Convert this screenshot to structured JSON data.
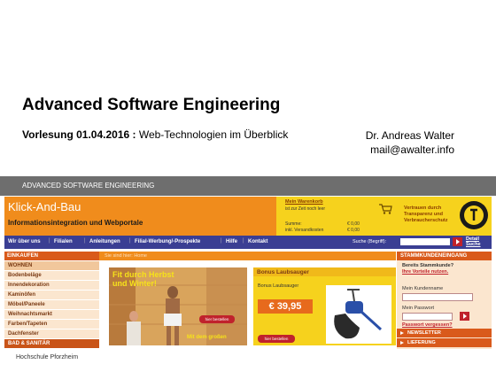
{
  "slide": {
    "title": "Advanced Software Engineering",
    "lecture_label": "Vorlesung 01.04.2016 :",
    "lecture_topic": " Web-Technologien im Überblick",
    "author": "Dr. Andreas Walter",
    "email": "mail@awalter.info",
    "banner": "ADVANCED SOFTWARE ENGINEERING",
    "footer": "Hochschule Pforzheim"
  },
  "site": {
    "brand": "Klick-And-Bau",
    "tagline": "Informationsintegration und Webportale",
    "cart": {
      "title": "Mein Warenkorb",
      "note": "ist zur Zeit noch leer",
      "sum_label": "Summe:",
      "sum_value": "€ 0,00",
      "shipping_label": "inkl. Versandkosten",
      "shipping_value": "€ 0,00"
    },
    "trust": {
      "text": "Vertrauen durch Transparenz und Verbraucherschutz"
    },
    "nav": [
      "Wir über uns",
      "Filialen",
      "Anleitungen",
      "Filial-Werbung/-Prospekte",
      "Hilfe",
      "Kontakt"
    ],
    "search": {
      "label": "Suche (Begriff):",
      "detail": "Detail Suche"
    },
    "categories_header": "EINKAUFEN",
    "categories": [
      "WOHNEN",
      "Bodenbeläge",
      "Innendekoration",
      "Kaminöfen",
      "Möbel/Paneele",
      "Weihnachtsmarkt",
      "Farben/Tapeten",
      "Dachfenster",
      "BAD & SANITÄR"
    ],
    "breadcrumb": "Sie sind hier: Home",
    "promo": {
      "headline": "Fit durch Herbst und Winter!",
      "button": "hier bestellen",
      "link": "Mit dem großen"
    },
    "bonus": {
      "header": "Bonus Laubsauger",
      "name": "Bonus Laubsauger",
      "price": "€ 39,95",
      "button": "hier bestellen"
    },
    "login": {
      "header": "STAMMKUNDENEINGANG",
      "question": "Bereits Stammkunde?",
      "benefits_link": "Ihre Vorteile nutzen.",
      "name_label": "Mein Kundenname",
      "password_label": "Mein Passwort",
      "forgot_link": "Passwort vergessen?"
    },
    "side_links": [
      "NEWSLETTER",
      "LIEFERUNG"
    ]
  },
  "colors": {
    "orange": "#f08c1c",
    "nav_blue": "#3a3e93",
    "yellow": "#f6d21d",
    "red": "#c0222c",
    "banner_gray": "#6e6e6e"
  }
}
